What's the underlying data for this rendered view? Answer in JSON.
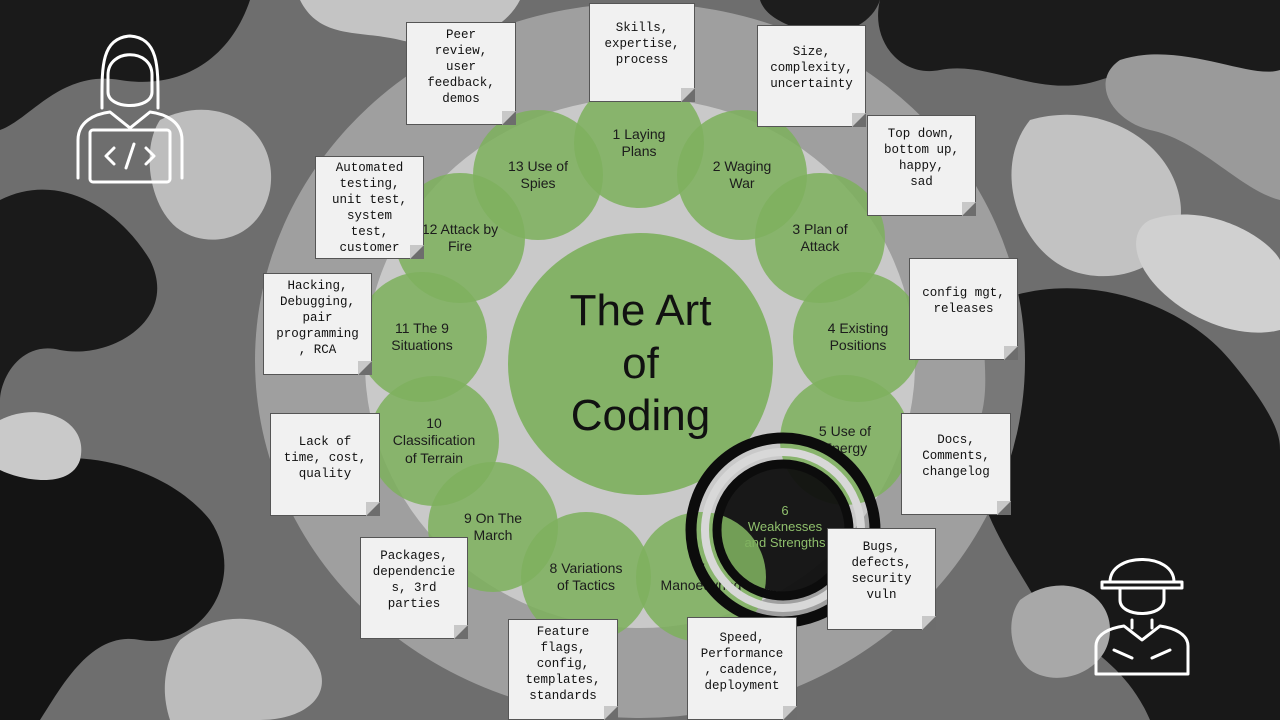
{
  "title": "The Art\nof\nCoding",
  "chapters": [
    {
      "id": "laying-plans",
      "label": "1 Laying\nPlans"
    },
    {
      "id": "waging-war",
      "label": "2 Waging\nWar"
    },
    {
      "id": "plan-of-attack",
      "label": "3 Plan of\nAttack"
    },
    {
      "id": "existing-positions",
      "label": "4 Existing\nPositions"
    },
    {
      "id": "use-of-energy",
      "label": "5 Use of\nEnergy"
    },
    {
      "id": "weaknesses",
      "label": "6\nWeaknesses\nand Strengths"
    },
    {
      "id": "manoeuvring",
      "label": "7\nManoeuvring"
    },
    {
      "id": "variations",
      "label": "8 Variations\nof Tactics"
    },
    {
      "id": "on-the-march",
      "label": "9 On The\nMarch"
    },
    {
      "id": "terrain",
      "label": "10\nClassification\nof Terrain"
    },
    {
      "id": "nine-situations",
      "label": "11 The 9\nSituations"
    },
    {
      "id": "attack-by-fire",
      "label": "12 Attack by\nFire"
    },
    {
      "id": "use-of-spies",
      "label": "13 Use of\nSpies"
    }
  ],
  "notes": [
    {
      "id": "skills",
      "text": "Skills,\nexpertise,\nprocess"
    },
    {
      "id": "size",
      "text": "Size,\ncomplexity,\nuncertainty"
    },
    {
      "id": "topdown",
      "text": "Top down,\nbottom up,\nhappy,\nsad"
    },
    {
      "id": "config",
      "text": "config mgt,\nreleases"
    },
    {
      "id": "docs",
      "text": "Docs,\nComments,\nchangelog"
    },
    {
      "id": "bugs",
      "text": "Bugs,\ndefects,\nsecurity\nvuln"
    },
    {
      "id": "speed",
      "text": "Speed,\nPerformance\n, cadence,\ndeployment"
    },
    {
      "id": "feature",
      "text": "Feature\nflags,\nconfig,\ntemplates,\nstandards"
    },
    {
      "id": "packages",
      "text": "Packages,\ndependencie\ns, 3rd\nparties"
    },
    {
      "id": "lack",
      "text": "Lack of\ntime, cost,\nquality"
    },
    {
      "id": "hacking",
      "text": "Hacking,\nDebugging,\npair\nprogramming\n, RCA"
    },
    {
      "id": "automated",
      "text": "Automated\ntesting,\nunit test,\nsystem\ntest,\ncustomer"
    },
    {
      "id": "peer",
      "text": "Peer\nreview,\nuser\nfeedback,\ndemos"
    }
  ],
  "icons": [
    "developer-laptop-icon",
    "soldier-icon"
  ]
}
